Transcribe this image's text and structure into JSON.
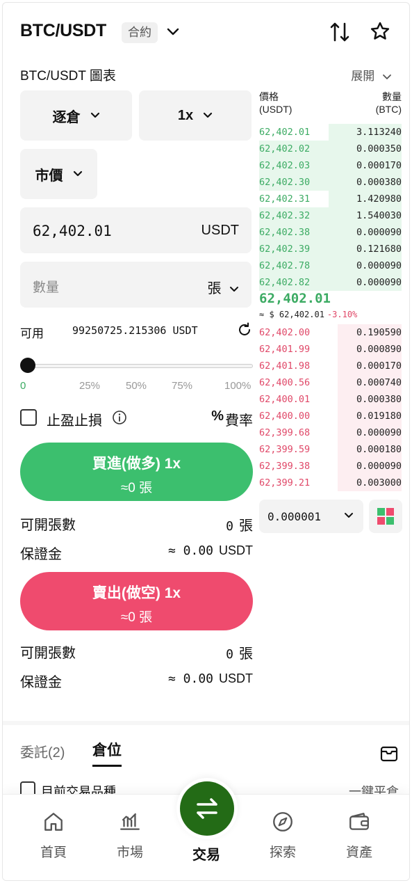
{
  "header": {
    "pair": "BTC/USDT",
    "badge": "合約",
    "chart_title": "BTC/USDT 圖表",
    "expand_label": "展開"
  },
  "form": {
    "margin_mode": "逐倉",
    "leverage": "1x",
    "order_type": "市價",
    "price_value": "62,402.01",
    "price_unit": "USDT",
    "qty_placeholder": "數量",
    "qty_unit": "張",
    "available_label": "可用",
    "available_value": "99250725.215306 USDT",
    "slider_ticks": [
      "0",
      "25%",
      "50%",
      "75%",
      "100%"
    ],
    "slider_percent": 0,
    "tpsl_label": "止盈止損",
    "pct_symbol": "%",
    "fee_label": "費率",
    "buy_label": "買進(做多) 1x",
    "buy_sub": "≈0 張",
    "sell_label": "賣出(做空) 1x",
    "sell_sub": "≈0 張",
    "buy_info": [
      {
        "k": "可開張數",
        "v": "0",
        "u": "張"
      },
      {
        "k": "保證金",
        "v": "≈ 0.00",
        "u": "USDT"
      }
    ],
    "sell_info": [
      {
        "k": "可開張數",
        "v": "0",
        "u": "張"
      },
      {
        "k": "保證金",
        "v": "≈ 0.00",
        "u": "USDT"
      }
    ]
  },
  "orderbook": {
    "price_header": "價格",
    "price_header_unit": "(USDT)",
    "qty_header": "數量",
    "qty_header_unit": "(BTC)",
    "asks": [
      {
        "p": "62,402.01",
        "q": "3.113240",
        "d": 0.51
      },
      {
        "p": "62,402.02",
        "q": "0.000350",
        "d": 1
      },
      {
        "p": "62,402.03",
        "q": "0.000170",
        "d": 1
      },
      {
        "p": "62,402.30",
        "q": "0.000380",
        "d": 1
      },
      {
        "p": "62,402.31",
        "q": "1.420980",
        "d": 0.51
      },
      {
        "p": "62,402.32",
        "q": "1.540030",
        "d": 1
      },
      {
        "p": "62,402.38",
        "q": "0.000090",
        "d": 1
      },
      {
        "p": "62,402.39",
        "q": "0.121680",
        "d": 1
      },
      {
        "p": "62,402.78",
        "q": "0.000090",
        "d": 1
      },
      {
        "p": "62,402.82",
        "q": "0.000090",
        "d": 1
      }
    ],
    "last_price": "62,402.01",
    "last_usd": "≈ $ 62,402.01",
    "last_change": "-3.10%",
    "bids": [
      {
        "p": "62,402.00",
        "q": "0.190590",
        "d": 0.45
      },
      {
        "p": "62,401.99",
        "q": "0.000890",
        "d": 0.45
      },
      {
        "p": "62,401.98",
        "q": "0.000170",
        "d": 0.45
      },
      {
        "p": "62,400.56",
        "q": "0.000740",
        "d": 0.45
      },
      {
        "p": "62,400.01",
        "q": "0.000380",
        "d": 0.45
      },
      {
        "p": "62,400.00",
        "q": "0.019180",
        "d": 0.45
      },
      {
        "p": "62,399.68",
        "q": "0.000090",
        "d": 0.45
      },
      {
        "p": "62,399.59",
        "q": "0.000180",
        "d": 0.45
      },
      {
        "p": "62,399.38",
        "q": "0.000090",
        "d": 0.45
      },
      {
        "p": "62,399.21",
        "q": "0.003000",
        "d": 0.45
      }
    ],
    "precision": "0.000001"
  },
  "positions": {
    "tab_orders": "委託(2)",
    "tab_positions": "倉位",
    "current_only": "目前交易品種",
    "close_all": "一鍵平倉"
  },
  "nav": {
    "home": "首頁",
    "market": "市場",
    "trade": "交易",
    "explore": "探索",
    "assets": "資產"
  },
  "colors": {
    "buy": "#3cbf6e",
    "sell": "#ef4b6e",
    "ask_text": "#3cab63",
    "bid_text": "#e04868",
    "nav_center": "#236b16"
  }
}
